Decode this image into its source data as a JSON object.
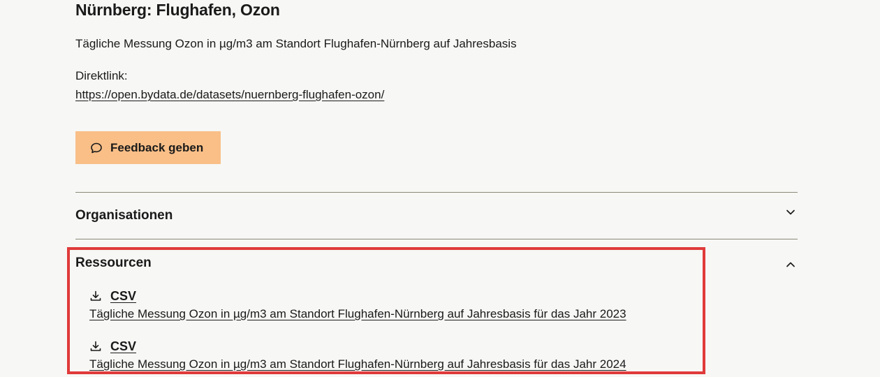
{
  "dataset": {
    "title": "Nürnberg: Flughafen, Ozon",
    "description": "Tägliche Messung Ozon in µg/m3 am Standort Flughafen-Nürnberg auf Jahresbasis",
    "direktlink_label": "Direktlink:",
    "direktlink_url": "https://open.bydata.de/datasets/nuernberg-flughafen-ozon/"
  },
  "feedback": {
    "label": "Feedback geben",
    "icon": "speech-bubble-icon",
    "color": "#f9bf87"
  },
  "sections": {
    "organisationen": {
      "title": "Organisationen",
      "state": "collapsed"
    },
    "ressourcen": {
      "title": "Ressourcen",
      "state": "expanded",
      "items": [
        {
          "format": "CSV",
          "description": "Tägliche Messung Ozon in µg/m3 am Standort Flughafen-Nürnberg auf Jahresbasis für das Jahr 2023",
          "icon": "download-icon"
        },
        {
          "format": "CSV",
          "description": "Tägliche Messung Ozon in µg/m3 am Standort Flughafen-Nürnberg auf Jahresbasis für das Jahr 2024",
          "icon": "download-icon"
        }
      ]
    }
  },
  "highlight_color": "#e03a3a"
}
